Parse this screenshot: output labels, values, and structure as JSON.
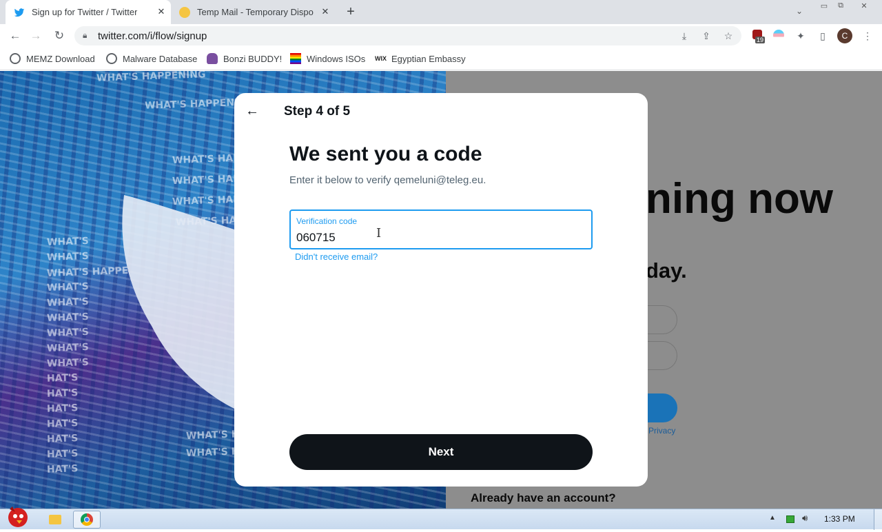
{
  "browser": {
    "tabs": [
      {
        "title": "Sign up for Twitter / Twitter",
        "active": true
      },
      {
        "title": "Temp Mail - Temporary Dispo",
        "active": false
      }
    ],
    "url": "twitter.com/i/flow/signup",
    "extension_badge": "19",
    "profile_initial": "C",
    "bookmarks": [
      {
        "label": "MEMZ Download",
        "icon": "globe-icon"
      },
      {
        "label": "Malware Database",
        "icon": "globe-icon"
      },
      {
        "label": "Bonzi BUDDY!",
        "icon": "bonzi-icon"
      },
      {
        "label": "Windows ISOs",
        "icon": "rainbow-flag-icon"
      },
      {
        "label": "Egyptian Embassy",
        "icon": "wix-icon"
      }
    ]
  },
  "background": {
    "headline_fragment": "ning now",
    "subheadline_fragment": "day.",
    "privacy_link": "Privacy",
    "login_prompt": "Already have an account?"
  },
  "modal": {
    "step": "Step 4 of 5",
    "heading": "We sent you a code",
    "subtitle": "Enter it below to verify qemeluni@teleg.eu.",
    "field_label": "Verification code",
    "field_value": "060715",
    "resend_link": "Didn't receive email?",
    "next_label": "Next"
  },
  "taskbar": {
    "time": "1:33 PM"
  },
  "colors": {
    "twitter_blue": "#1d9bf0",
    "button_dark": "#0f1419"
  }
}
